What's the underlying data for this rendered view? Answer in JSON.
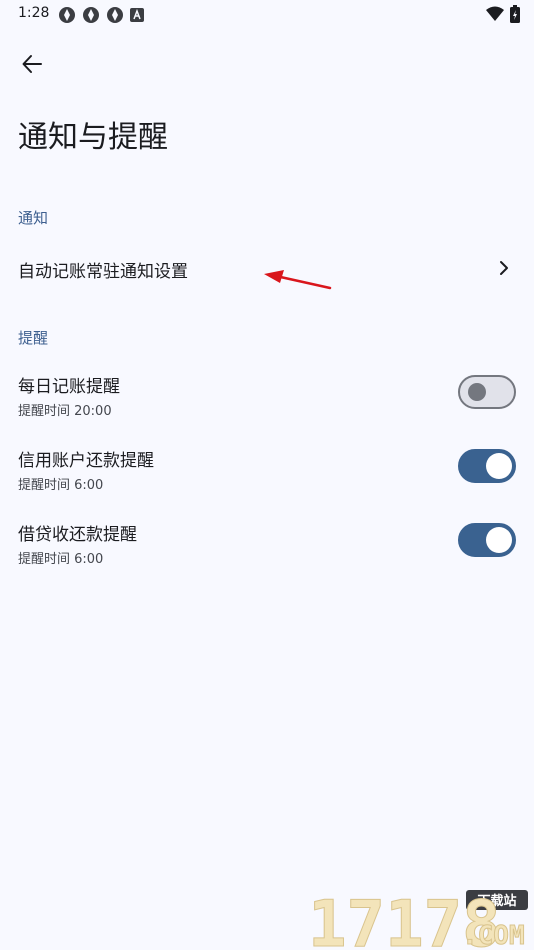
{
  "status_bar": {
    "time": "1:28",
    "notification_icons": [
      "aperture-icon",
      "aperture-icon",
      "aperture-icon",
      "a-box-icon"
    ],
    "right_icons": [
      "wifi-icon",
      "battery-charging-icon"
    ]
  },
  "header": {
    "back_icon": "arrow-left-icon",
    "title": "通知与提醒"
  },
  "sections": {
    "notification": {
      "header": "通知",
      "item_title": "自动记账常驻通知设置"
    },
    "reminder": {
      "header": "提醒",
      "items": [
        {
          "title": "每日记账提醒",
          "subtitle": "提醒时间 20:00",
          "enabled": false
        },
        {
          "title": "信用账户还款提醒",
          "subtitle": "提醒时间 6:00",
          "enabled": true
        },
        {
          "title": "借贷收还款提醒",
          "subtitle": "提醒时间 6:00",
          "enabled": true
        }
      ]
    }
  },
  "watermark": {
    "top": "下载站",
    "main": "17178",
    "suffix": ".COM"
  },
  "colors": {
    "background": "#f8f9ff",
    "section_header": "#3d5f8f",
    "switch_on": "#3a6290",
    "switch_off_track": "#e1e2ea",
    "switch_off_outline": "#74777f",
    "annotation_arrow": "#d9161c"
  }
}
